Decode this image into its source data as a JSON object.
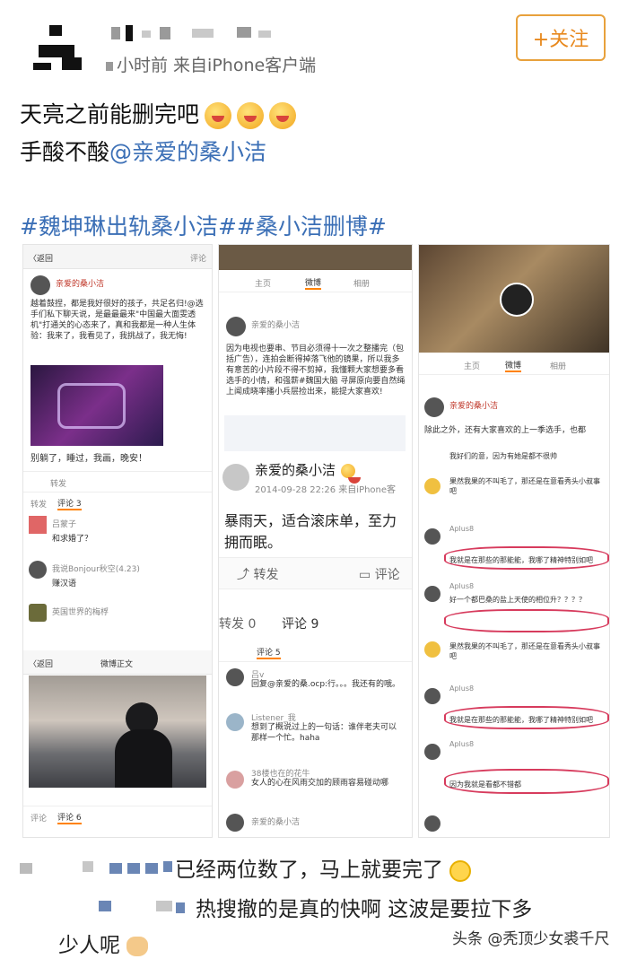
{
  "header": {
    "meta": "小时前  来自iPhone客户端",
    "follow_label": "+关注"
  },
  "post": {
    "line1": "天亮之前能删完吧",
    "line2_prefix": "手酸不酸",
    "mention": "@亲爱的桑小洁",
    "hashtags": "#魏坤琳出轨桑小洁##桑小洁删博#"
  },
  "shot_left": {
    "back": "〈返回",
    "right": "评论",
    "user": "亲爱的桑小洁",
    "body": "越着鼓捏，都是我好很好的孩子，共足名归!@选手们私下聊天说，是最最最来\"中国最大面雯透机\"打通关的心态来了，真和我都是一种人生体验：我来了，我看见了，我挑战了，我无悔!",
    "caption": "别躺了，睡过，我画，晚安！",
    "repost": "转发",
    "comment_tab": "评论 3",
    "c1_user": "吕蒙子",
    "c1_text": "和求婚了？",
    "c2_user": "我说Bonjour秋空(4.23)",
    "c2_text": "赚汉语",
    "c3_user": "英国世界的梅桴",
    "weibo_title": "微博正文",
    "back2": "〈返回",
    "bottom_tab1": "评论",
    "bottom_tab2": "评论 6"
  },
  "shot_mid": {
    "tab1": "主页",
    "tab2": "微博",
    "tab3": "相册",
    "user": "亲爱的桑小洁",
    "body": "因为电视也要串、节目必须得十一次之整播完（包括广告），连拍会断得掉落飞他的镜果，所以我多有意苦的小片段不得不剪掉，我懂颗大家想要多看选手的小情，和强薪#魏国大脑 寻屏原向要自然绳上闻成晓率播小兵层捡出来，能提大家喜欢!",
    "big_user": "亲爱的桑小洁",
    "big_time": "2014-09-28 22:26  来自iPhone客",
    "big_body1": "暴雨天，适合滚床单，至力",
    "big_body2": "拥而眠。",
    "repost_btn": "转发",
    "comment_btn": "评论",
    "count_repost": "转发 0",
    "count_comment": "评论 9",
    "comment_tab": "评论 5",
    "c1_user": "吕ⅴ",
    "c1_text": "回复@亲爱的桑.ocp:行。。。我还有的哦。",
    "c2_user": "Listener_我",
    "c2_text": "想到了概说过上的一句话：谁伴老夫可以那样一个忙。haha",
    "c3_user": "38楼也在的花牛",
    "c3_text": "女人的心在风雨交加的顾雨容易碰动哪",
    "c4_user": "亲爱的桑小洁"
  },
  "shot_right": {
    "tab1": "主页",
    "tab2": "微博",
    "tab3": "相册",
    "user": "亲爱的桑小洁",
    "body": "除此之外，还有大家喜欢的上一季选手，也都",
    "r1": "我好们的意，因为有她是都不很帅",
    "r2": "果然我果的不叫毛了，那还是在意看秀头小叔事吧",
    "r3_user": "Aplus8",
    "r3": "我就是在那些的那能能，我哪了精神特别如吧",
    "r4_user": "Aplus8",
    "r4": "好一个都巴桑的盐上天使的相位升？？？？",
    "r5": "果然我果的不叫毛了，那还是在意看秀头小叔事吧",
    "r6_user": "Aplus8",
    "r6": "我就是在那些的那能能，我哪了精神特别如吧",
    "r7_user": "Aplus8",
    "r7": "因为我就是看都不错都"
  },
  "comments_below": {
    "line1": "已经两位数了，马上就要完了",
    "line2": "热搜撤的是真的快啊  这波是要拉下多",
    "line3": "少人呢"
  },
  "source": "头条 @秃顶少女裘千尺",
  "colors": {
    "accent": "#e8891e",
    "link": "#3b6fb6",
    "underline": "#d73b5d"
  }
}
